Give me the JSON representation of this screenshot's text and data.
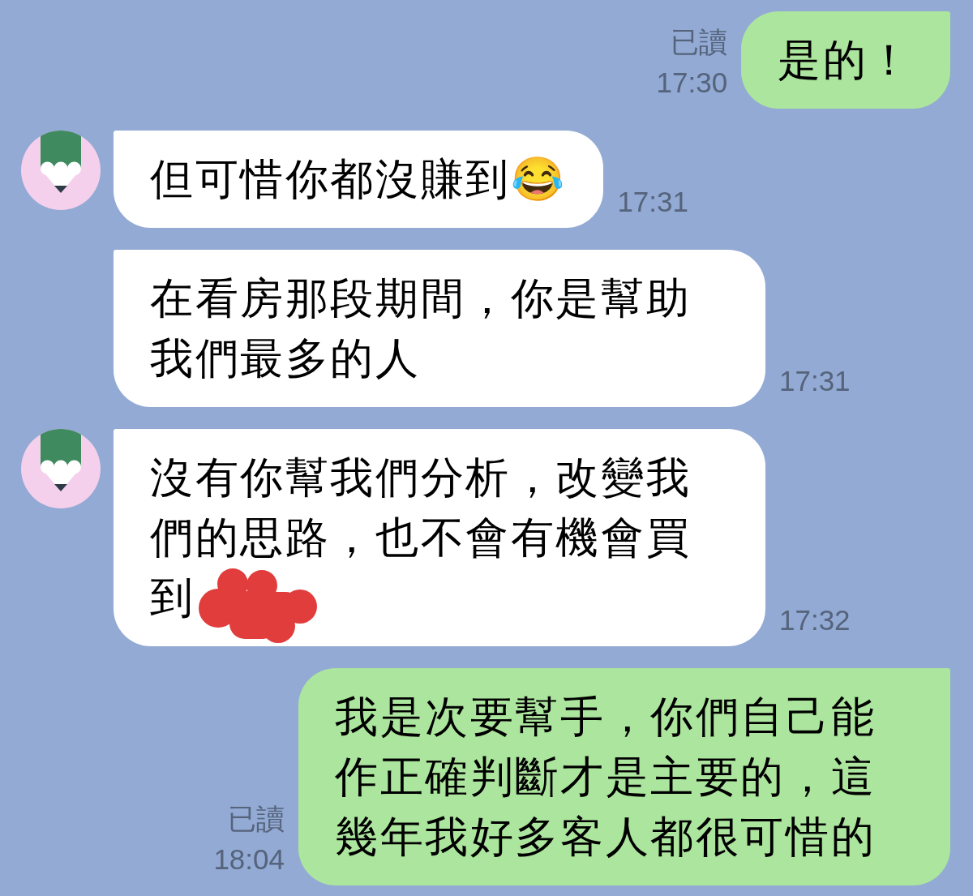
{
  "chat": {
    "messages": [
      {
        "kind": "outgoing",
        "text": "是的！",
        "read": "已讀",
        "time": "17:30",
        "redacted": false
      },
      {
        "kind": "incoming",
        "avatar": true,
        "text": "但可惜你都沒賺到😂",
        "time": "17:31",
        "redacted": false
      },
      {
        "kind": "incoming",
        "avatar": false,
        "text": "在看房那段期間，你是幫助我們最多的人",
        "time": "17:31",
        "redacted": false
      },
      {
        "kind": "incoming",
        "avatar": true,
        "text": "沒有你幫我們分析，改變我們的思路，也不會有機會買到",
        "time": "17:32",
        "redacted": true
      },
      {
        "kind": "outgoing",
        "text": "我是次要幫手，你們自己能作正確判斷才是主要的，這幾年我好多客人都很可惜的",
        "read": "已讀",
        "time": "18:04",
        "redacted": false
      }
    ]
  }
}
